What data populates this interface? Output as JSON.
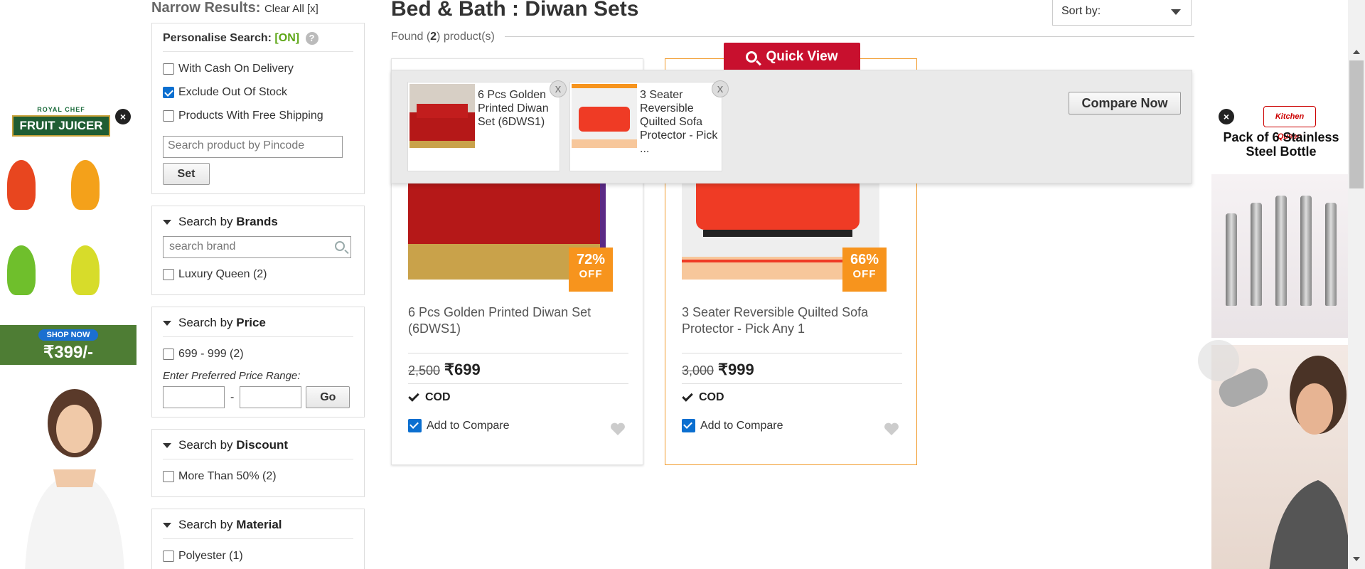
{
  "left_ad": {
    "brand_small": "ROYAL CHEF",
    "brand_big": "FRUIT JUICER",
    "shop_label": "SHOP NOW",
    "price": "₹399/-"
  },
  "right_ad": {
    "logo": "Kitchen Queen",
    "headline": "Pack of 6 Stainless Steel Bottle"
  },
  "sidebar": {
    "narrow_title": "Narrow Results:",
    "clear_all": "Clear All [x]",
    "personalise": {
      "label": "Personalise Search:",
      "status": "[ON]",
      "help": "?",
      "options": [
        {
          "label": "With Cash On Delivery",
          "checked": false
        },
        {
          "label": "Exclude Out Of Stock",
          "checked": true
        },
        {
          "label": "Products With Free Shipping",
          "checked": false
        }
      ],
      "pincode_placeholder": "Search product by Pincode",
      "set_label": "Set"
    },
    "brands": {
      "prefix": "Search by ",
      "title": "Brands",
      "search_placeholder": "search brand",
      "items": [
        {
          "label": "Luxury Queen (2)",
          "checked": false
        }
      ]
    },
    "price": {
      "prefix": "Search by ",
      "title": "Price",
      "items": [
        {
          "label": "699 - 999 (2)",
          "checked": false
        }
      ],
      "range_label": "Enter Preferred Price Range:",
      "dash": "-",
      "go_label": "Go"
    },
    "discount": {
      "prefix": "Search by ",
      "title": "Discount",
      "items": [
        {
          "label": "More Than 50% (2)",
          "checked": false
        }
      ]
    },
    "material": {
      "prefix": "Search by ",
      "title": "Material",
      "items": [
        {
          "label": "Polyester (1)",
          "checked": false
        }
      ]
    }
  },
  "main": {
    "title": "Bed & Bath : Diwan Sets",
    "found_prefix": "Found (",
    "found_count": "2",
    "found_suffix": ") product(s)",
    "sort_label": "Sort by:",
    "quick_view": "Quick View",
    "products": [
      {
        "name": "6 Pcs Golden Printed Diwan Set (6DWS1)",
        "mrp": "2,500",
        "currency": "₹",
        "price": "699",
        "discount_pct": "72%",
        "discount_off": "OFF",
        "cod": "COD",
        "compare_label": "Add to Compare",
        "compare_checked": true
      },
      {
        "name": "3 Seater Reversible Quilted Sofa Protector - Pick Any 1",
        "mrp": "3,000",
        "currency": "₹",
        "price": "999",
        "discount_pct": "66%",
        "discount_off": "OFF",
        "cod": "COD",
        "compare_label": "Add to Compare",
        "compare_checked": true
      }
    ]
  },
  "compare_bar": {
    "items": [
      {
        "name": "6 Pcs Golden Printed Diwan Set (6DWS1)",
        "close": "x"
      },
      {
        "name": "3 Seater Reversible Quilted Sofa Protector - Pick ...",
        "close": "x"
      }
    ],
    "compare_now": "Compare Now"
  },
  "colors": {
    "accent_red": "#c8102e",
    "discount_orange": "#f7941d",
    "on_green": "#5ca615",
    "active_border": "#f19b2c"
  }
}
